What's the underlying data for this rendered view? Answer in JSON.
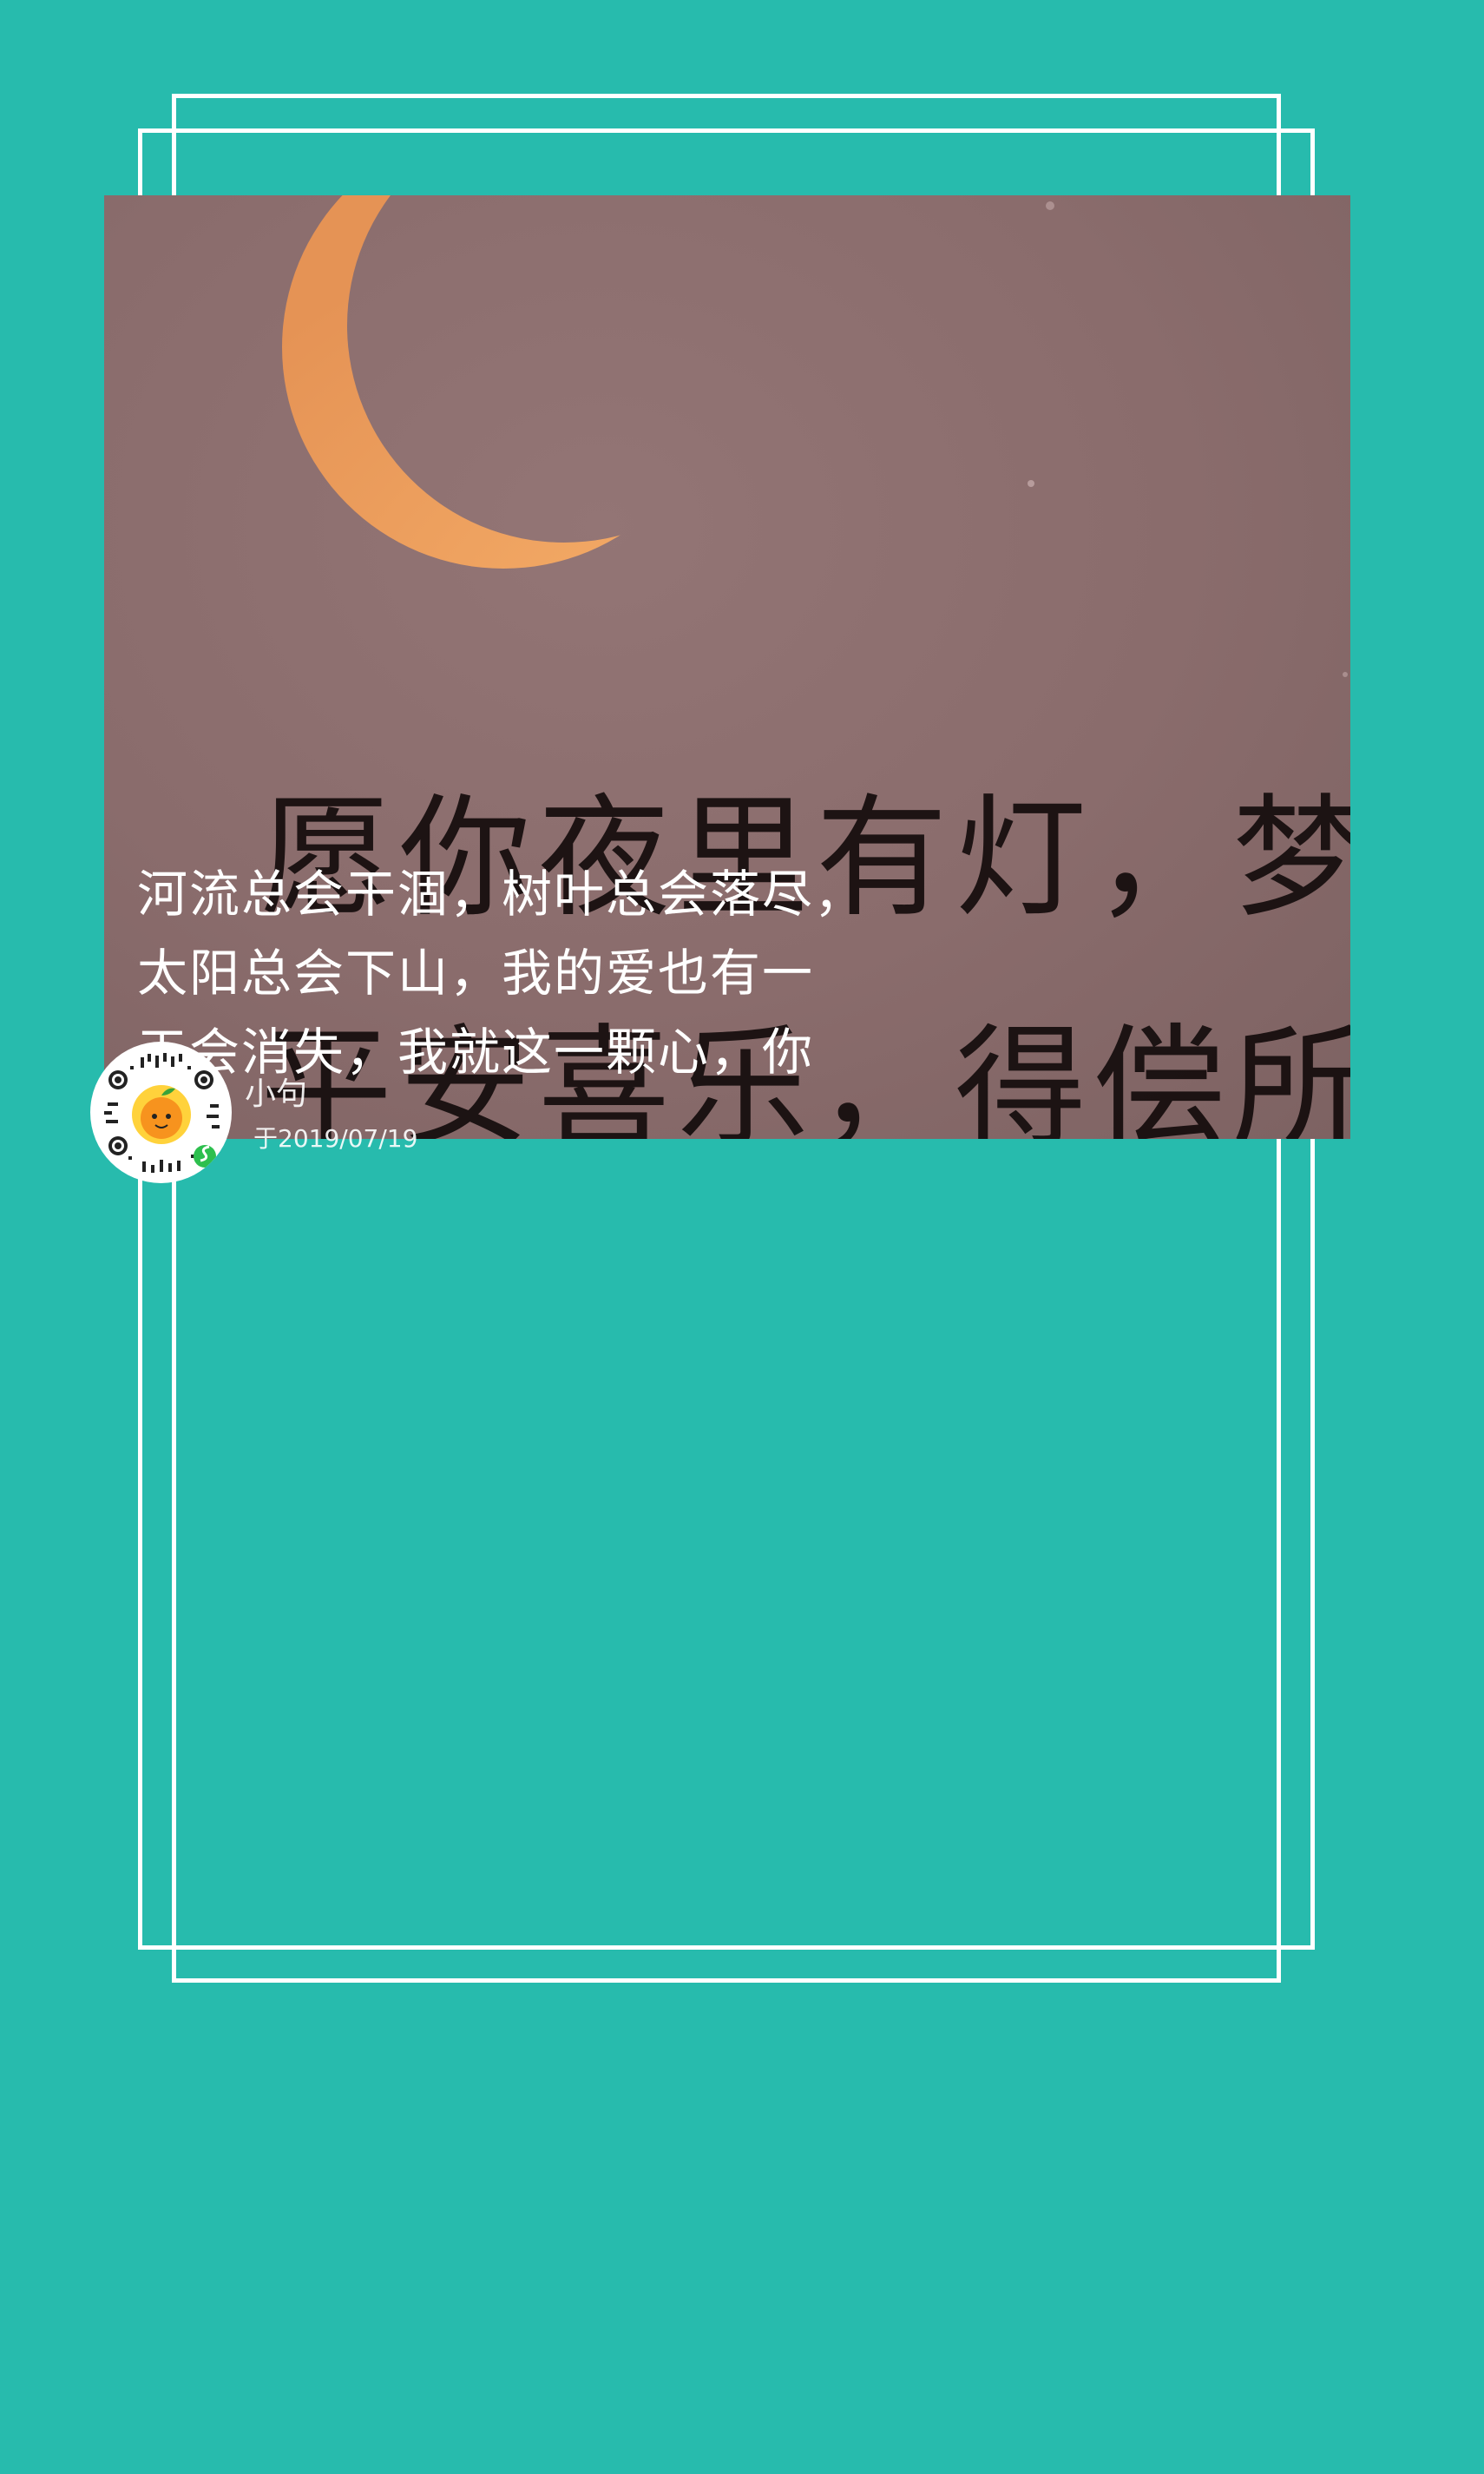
{
  "colors": {
    "background": "#27bbad",
    "frame": "#ffffff",
    "photo_tint": "#8a6c6c",
    "moon": "#f3a05e",
    "text": "#ffffff"
  },
  "photo": {
    "caption_line_1": "愿你夜里有灯，梦里",
    "caption_line_2": "平安喜乐，得偿所愿"
  },
  "quote": {
    "lines": [
      "河流总会干涸，树叶总会落尽，",
      "太阳总会下山，我的爱也有一",
      "天会消失，我就这一颗心，你"
    ]
  },
  "author": {
    "name": "小句",
    "date": "于2019/07/19"
  },
  "icons": {
    "qr": "mini-program-qr-code-icon",
    "mascot": "orange-mascot-icon",
    "badge": "wechat-mini-program-badge-icon"
  }
}
